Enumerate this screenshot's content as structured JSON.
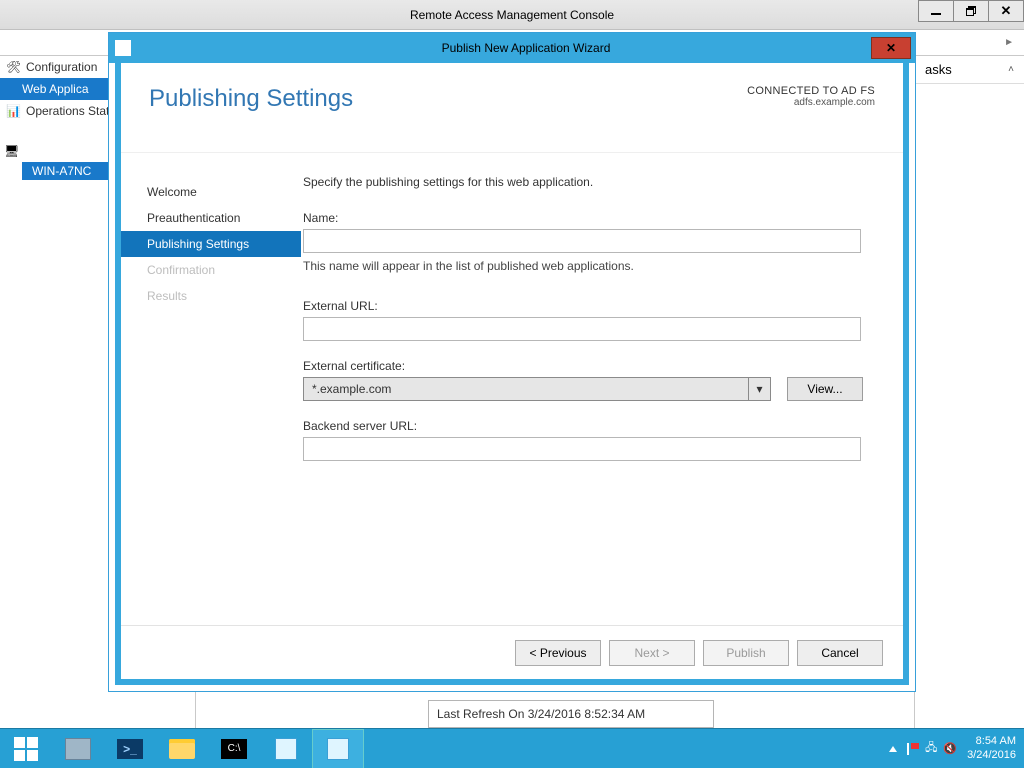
{
  "outer": {
    "title": "Remote Access Management Console",
    "tree": {
      "configuration": "Configuration",
      "web_app_proxy": "Web Applica",
      "operations": "Operations Stat",
      "server": "WIN-A7NC"
    },
    "tasks_header": "asks",
    "refresh_status": "Last Refresh On 3/24/2016 8:52:34 AM"
  },
  "wizard": {
    "title": "Publish New Application Wizard",
    "page_heading": "Publishing Settings",
    "connected_line1": "CONNECTED TO AD FS",
    "connected_line2": "adfs.example.com",
    "steps": {
      "welcome": "Welcome",
      "preauth": "Preauthentication",
      "publishing": "Publishing Settings",
      "confirmation": "Confirmation",
      "results": "Results"
    },
    "form": {
      "descr": "Specify the publishing settings for this web application.",
      "name_label": "Name:",
      "name_value": "",
      "name_hint": "This name will appear in the list of published web applications.",
      "ext_url_label": "External URL:",
      "ext_url_value": "",
      "ext_cert_label": "External certificate:",
      "ext_cert_value": "*.example.com",
      "view_button": "View...",
      "backend_label": "Backend server URL:",
      "backend_value": ""
    },
    "footer": {
      "previous": "< Previous",
      "next": "Next >",
      "publish": "Publish",
      "cancel": "Cancel"
    }
  },
  "taskbar": {
    "time": "8:54 AM",
    "date": "3/24/2016"
  }
}
